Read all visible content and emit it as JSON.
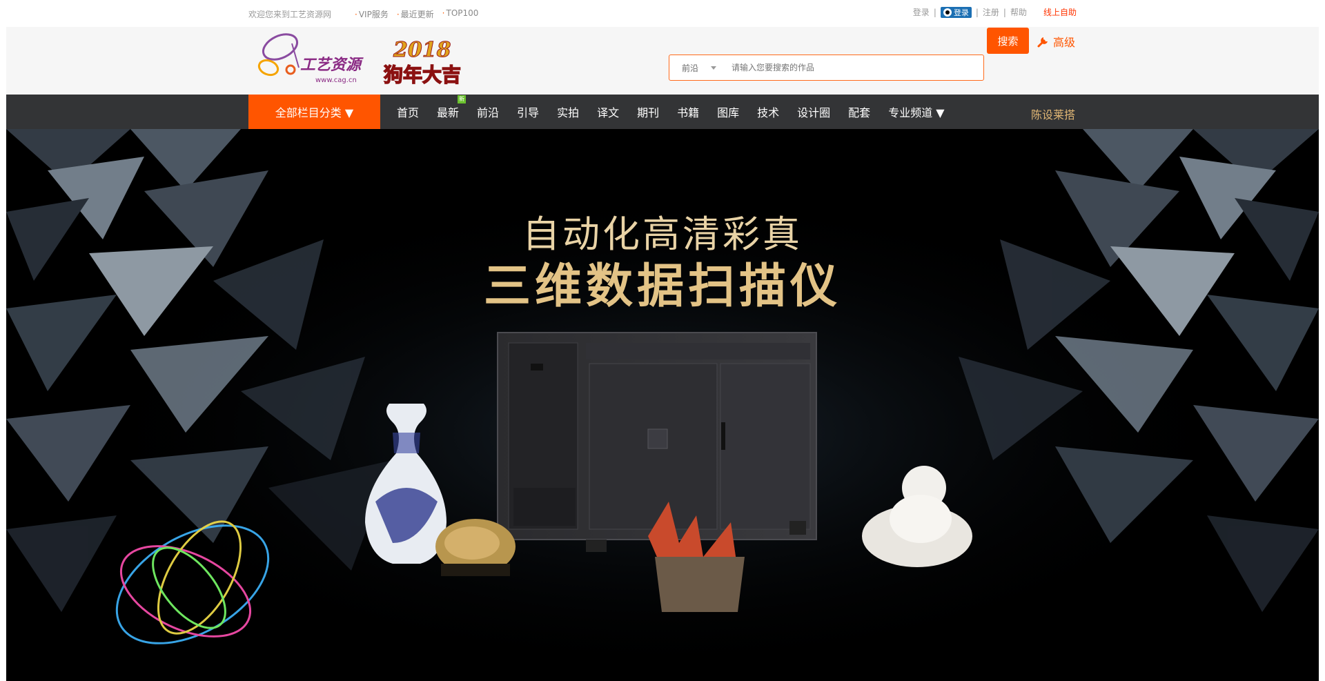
{
  "topbar": {
    "welcome": "欢迎您来到工艺资源网",
    "links": [
      "VIP服务",
      "最近更新",
      "TOP100"
    ],
    "login": "登录",
    "qq_login": "登录",
    "register": "注册",
    "help": "帮助",
    "online_help": "线上自助"
  },
  "header": {
    "logo_text": "工艺资源",
    "logo_url": "www.cag.cn",
    "newyear_text": "狗年大吉",
    "newyear_year": "2018"
  },
  "search": {
    "category": "前沿",
    "placeholder": "请输入您要搜索的作品",
    "button": "搜索",
    "advanced": "高级"
  },
  "nav": {
    "all_categories": "全部栏目分类 ▼",
    "items": [
      "首页",
      "最新",
      "前沿",
      "引导",
      "实拍",
      "译文",
      "期刊",
      "书籍",
      "图库",
      "技术",
      "设计圈",
      "配套",
      "专业频道 ▼"
    ],
    "new_badge": "新",
    "special": "陈设莱搭"
  },
  "banner": {
    "line1": "自动化高清彩真",
    "line2": "三维数据扫描仪"
  },
  "colors": {
    "accent": "#ff5500",
    "nav_bg": "#333436",
    "gold": "#e3c386"
  }
}
